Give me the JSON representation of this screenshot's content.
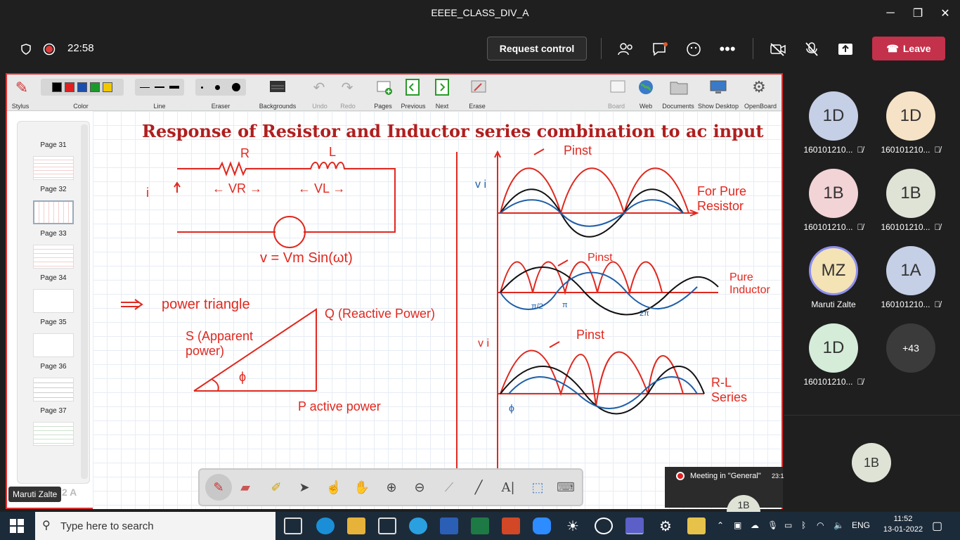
{
  "window": {
    "title": "EEEE_CLASS_DIV_A",
    "min": "─",
    "max": "❐",
    "close": "✕"
  },
  "meeting": {
    "timer": "22:58",
    "request_control": "Request control",
    "leave": "Leave"
  },
  "whiteboard": {
    "toolbar": {
      "stylus": "Stylus",
      "color": "Color",
      "line": "Line",
      "eraser": "Eraser",
      "backgrounds": "Backgrounds",
      "undo": "Undo",
      "redo": "Redo",
      "pages": "Pages",
      "previous": "Previous",
      "next": "Next",
      "erase": "Erase",
      "board": "Board",
      "web": "Web",
      "documents": "Documents",
      "show_desktop": "Show Desktop",
      "openboard": "OpenBoard"
    },
    "pages": [
      "Page 31",
      "Page 32",
      "Page 33",
      "Page 34",
      "Page 35",
      "Page 36",
      "Page 37"
    ],
    "heading": "Response of Resistor and Inductor series combination to ac input",
    "notes": {
      "R": "R",
      "L": "L",
      "vr": "← VR →",
      "vl": "← VL →",
      "i": "i",
      "eq": "v = Vm Sin(ωt)",
      "arrow": "⇒",
      "power_triangle": "power triangle",
      "S": "S (Apparent power)",
      "Q": "Q (Reactive Power)",
      "phi": "ϕ",
      "P": "P active power",
      "pinst1": "Pinst",
      "pinst2": "Pinst",
      "pinst3": "Pinst",
      "pure_resistor": "For Pure Resistor",
      "pure_inductor": "Pure Inductor",
      "rl_series": "R-L Series",
      "vi1": "v i",
      "vi3": "v i",
      "phi2": "ϕ",
      "pi2": "π/2",
      "pi": "π",
      "twopi": "2π"
    }
  },
  "presenter": "Maruti Zalte",
  "page_indicator": "2 A",
  "meeting_notice": {
    "text": "Meeting in \"General\"",
    "time": "23:1"
  },
  "participants": [
    {
      "initials": "1D",
      "name": "160101210...",
      "color": "#c5cfe6"
    },
    {
      "initials": "1D",
      "name": "160101210...",
      "color": "#f6e2c6"
    },
    {
      "initials": "1B",
      "name": "160101210...",
      "color": "#f2d3d6"
    },
    {
      "initials": "1B",
      "name": "160101210...",
      "color": "#dfe3d6"
    },
    {
      "initials": "MZ",
      "name": "Maruti Zalte",
      "color": "#f4e3b5"
    },
    {
      "initials": "1A",
      "name": "160101210...",
      "color": "#c5cfe6"
    },
    {
      "initials": "1D",
      "name": "160101210...",
      "color": "#d4ecd8"
    },
    {
      "initials": "+43",
      "name": "",
      "color": "#3b3b3b"
    }
  ],
  "self_avatar": "1B",
  "taskbar": {
    "search_placeholder": "Type here to search",
    "lang": "ENG",
    "time": "11:52",
    "date": "13-01-2022"
  }
}
